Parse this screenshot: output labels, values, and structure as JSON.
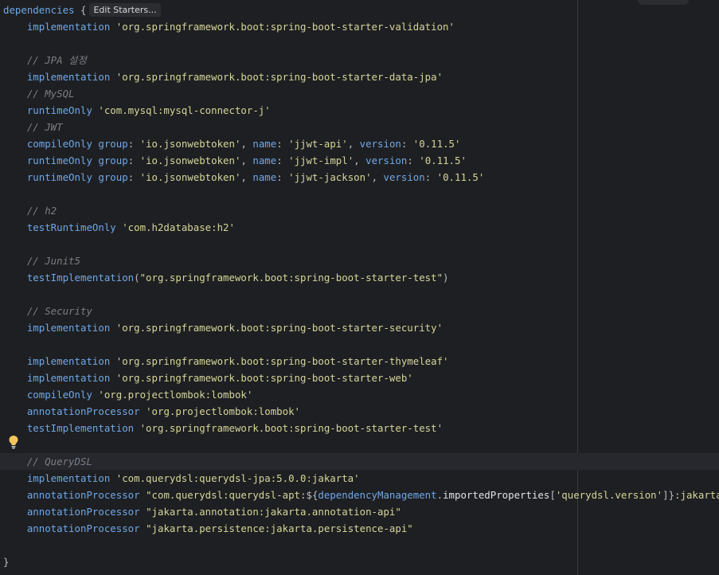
{
  "editor": {
    "edit_starters_label": "Edit Starters...",
    "lines": [
      {
        "parts": [
          {
            "t": "kw",
            "v": "dependencies"
          },
          {
            "t": "plain",
            "v": " {"
          }
        ],
        "hint": true
      },
      {
        "parts": [
          {
            "t": "plain",
            "v": "    "
          },
          {
            "t": "kw",
            "v": "implementation"
          },
          {
            "t": "plain",
            "v": " "
          },
          {
            "t": "str",
            "v": "'org.springframework.boot:spring-boot-starter-validation'"
          }
        ]
      },
      {
        "parts": []
      },
      {
        "parts": [
          {
            "t": "plain",
            "v": "    "
          },
          {
            "t": "cmt",
            "v": "// JPA 설정"
          }
        ]
      },
      {
        "parts": [
          {
            "t": "plain",
            "v": "    "
          },
          {
            "t": "kw",
            "v": "implementation"
          },
          {
            "t": "plain",
            "v": " "
          },
          {
            "t": "str",
            "v": "'org.springframework.boot:spring-boot-starter-data-jpa'"
          }
        ]
      },
      {
        "parts": [
          {
            "t": "plain",
            "v": "    "
          },
          {
            "t": "cmt",
            "v": "// MySQL"
          }
        ]
      },
      {
        "parts": [
          {
            "t": "plain",
            "v": "    "
          },
          {
            "t": "kw",
            "v": "runtimeOnly"
          },
          {
            "t": "plain",
            "v": " "
          },
          {
            "t": "str",
            "v": "'com.mysql:mysql-connector-j'"
          }
        ]
      },
      {
        "parts": [
          {
            "t": "plain",
            "v": "    "
          },
          {
            "t": "cmt",
            "v": "// JWT"
          }
        ]
      },
      {
        "parts": [
          {
            "t": "plain",
            "v": "    "
          },
          {
            "t": "kw",
            "v": "compileOnly"
          },
          {
            "t": "plain",
            "v": " "
          },
          {
            "t": "kw",
            "v": "group"
          },
          {
            "t": "plain",
            "v": ": "
          },
          {
            "t": "str",
            "v": "'io.jsonwebtoken'"
          },
          {
            "t": "plain",
            "v": ", "
          },
          {
            "t": "kw",
            "v": "name"
          },
          {
            "t": "plain",
            "v": ": "
          },
          {
            "t": "str",
            "v": "'jjwt-api'"
          },
          {
            "t": "plain",
            "v": ", "
          },
          {
            "t": "kw",
            "v": "version"
          },
          {
            "t": "plain",
            "v": ": "
          },
          {
            "t": "str",
            "v": "'0.11.5'"
          }
        ]
      },
      {
        "parts": [
          {
            "t": "plain",
            "v": "    "
          },
          {
            "t": "kw",
            "v": "runtimeOnly"
          },
          {
            "t": "plain",
            "v": " "
          },
          {
            "t": "kw",
            "v": "group"
          },
          {
            "t": "plain",
            "v": ": "
          },
          {
            "t": "str",
            "v": "'io.jsonwebtoken'"
          },
          {
            "t": "plain",
            "v": ", "
          },
          {
            "t": "kw",
            "v": "name"
          },
          {
            "t": "plain",
            "v": ": "
          },
          {
            "t": "str",
            "v": "'jjwt-impl'"
          },
          {
            "t": "plain",
            "v": ", "
          },
          {
            "t": "kw",
            "v": "version"
          },
          {
            "t": "plain",
            "v": ": "
          },
          {
            "t": "str",
            "v": "'0.11.5'"
          }
        ]
      },
      {
        "parts": [
          {
            "t": "plain",
            "v": "    "
          },
          {
            "t": "kw",
            "v": "runtimeOnly"
          },
          {
            "t": "plain",
            "v": " "
          },
          {
            "t": "kw",
            "v": "group"
          },
          {
            "t": "plain",
            "v": ": "
          },
          {
            "t": "str",
            "v": "'io.jsonwebtoken'"
          },
          {
            "t": "plain",
            "v": ", "
          },
          {
            "t": "kw",
            "v": "name"
          },
          {
            "t": "plain",
            "v": ": "
          },
          {
            "t": "str",
            "v": "'jjwt-jackson'"
          },
          {
            "t": "plain",
            "v": ", "
          },
          {
            "t": "kw",
            "v": "version"
          },
          {
            "t": "plain",
            "v": ": "
          },
          {
            "t": "str",
            "v": "'0.11.5'"
          }
        ]
      },
      {
        "parts": []
      },
      {
        "parts": [
          {
            "t": "plain",
            "v": "    "
          },
          {
            "t": "cmt",
            "v": "// h2"
          }
        ]
      },
      {
        "parts": [
          {
            "t": "plain",
            "v": "    "
          },
          {
            "t": "kw",
            "v": "testRuntimeOnly"
          },
          {
            "t": "plain",
            "v": " "
          },
          {
            "t": "str",
            "v": "'com.h2database:h2'"
          }
        ]
      },
      {
        "parts": []
      },
      {
        "parts": [
          {
            "t": "plain",
            "v": "    "
          },
          {
            "t": "cmt",
            "v": "// Junit5"
          }
        ]
      },
      {
        "parts": [
          {
            "t": "plain",
            "v": "    "
          },
          {
            "t": "kw",
            "v": "testImplementation"
          },
          {
            "t": "plain",
            "v": "("
          },
          {
            "t": "str2",
            "v": "\"org.springframework.boot:spring-boot-starter-test\""
          },
          {
            "t": "plain",
            "v": ")"
          }
        ]
      },
      {
        "parts": []
      },
      {
        "parts": [
          {
            "t": "plain",
            "v": "    "
          },
          {
            "t": "cmt",
            "v": "// Security"
          }
        ]
      },
      {
        "parts": [
          {
            "t": "plain",
            "v": "    "
          },
          {
            "t": "kw",
            "v": "implementation"
          },
          {
            "t": "plain",
            "v": " "
          },
          {
            "t": "str",
            "v": "'org.springframework.boot:spring-boot-starter-security'"
          }
        ]
      },
      {
        "parts": []
      },
      {
        "parts": [
          {
            "t": "plain",
            "v": "    "
          },
          {
            "t": "kw",
            "v": "implementation"
          },
          {
            "t": "plain",
            "v": " "
          },
          {
            "t": "str",
            "v": "'org.springframework.boot:spring-boot-starter-thymeleaf'"
          }
        ]
      },
      {
        "parts": [
          {
            "t": "plain",
            "v": "    "
          },
          {
            "t": "kw",
            "v": "implementation"
          },
          {
            "t": "plain",
            "v": " "
          },
          {
            "t": "str",
            "v": "'org.springframework.boot:spring-boot-starter-web'"
          }
        ]
      },
      {
        "parts": [
          {
            "t": "plain",
            "v": "    "
          },
          {
            "t": "kw",
            "v": "compileOnly"
          },
          {
            "t": "plain",
            "v": " "
          },
          {
            "t": "str",
            "v": "'org.projectlombok:lombok'"
          }
        ]
      },
      {
        "parts": [
          {
            "t": "plain",
            "v": "    "
          },
          {
            "t": "kw",
            "v": "annotationProcessor"
          },
          {
            "t": "plain",
            "v": " "
          },
          {
            "t": "str",
            "v": "'org.projectlombok:lombok'"
          }
        ]
      },
      {
        "parts": [
          {
            "t": "plain",
            "v": "    "
          },
          {
            "t": "kw",
            "v": "testImplementation"
          },
          {
            "t": "plain",
            "v": " "
          },
          {
            "t": "str",
            "v": "'org.springframework.boot:spring-boot-starter-test'"
          }
        ]
      },
      {
        "parts": []
      },
      {
        "parts": [
          {
            "t": "plain",
            "v": "    "
          },
          {
            "t": "cmt",
            "v": "// QueryDSL"
          }
        ],
        "current": true
      },
      {
        "parts": [
          {
            "t": "plain",
            "v": "    "
          },
          {
            "t": "kw",
            "v": "implementation"
          },
          {
            "t": "plain",
            "v": " "
          },
          {
            "t": "str",
            "v": "'com.querydsl:querydsl-jpa:5.0.0:jakarta'"
          }
        ]
      },
      {
        "parts": [
          {
            "t": "plain",
            "v": "    "
          },
          {
            "t": "kw",
            "v": "annotationProcessor"
          },
          {
            "t": "plain",
            "v": " "
          },
          {
            "t": "str2",
            "v": "\"com.querydsl:querydsl-apt:"
          },
          {
            "t": "plain",
            "v": "${"
          },
          {
            "t": "kw",
            "v": "dependencyManagement"
          },
          {
            "t": "plain",
            "v": "."
          },
          {
            "t": "ident",
            "v": "importedProperties"
          },
          {
            "t": "plain",
            "v": "["
          },
          {
            "t": "str",
            "v": "'querydsl.version'"
          },
          {
            "t": "plain",
            "v": "]}"
          },
          {
            "t": "str2",
            "v": ":jakarta\""
          }
        ]
      },
      {
        "parts": [
          {
            "t": "plain",
            "v": "    "
          },
          {
            "t": "kw",
            "v": "annotationProcessor"
          },
          {
            "t": "plain",
            "v": " "
          },
          {
            "t": "str2",
            "v": "\"jakarta.annotation:jakarta.annotation-api\""
          }
        ]
      },
      {
        "parts": [
          {
            "t": "plain",
            "v": "    "
          },
          {
            "t": "kw",
            "v": "annotationProcessor"
          },
          {
            "t": "plain",
            "v": " "
          },
          {
            "t": "str2",
            "v": "\"jakarta.persistence:jakarta.persistence-api\""
          }
        ]
      },
      {
        "parts": []
      },
      {
        "parts": [
          {
            "t": "plain",
            "v": "}"
          }
        ]
      }
    ]
  },
  "icons": {
    "gutter_icon": "lightbulb-icon",
    "bulb_color": "#f2c55c"
  }
}
